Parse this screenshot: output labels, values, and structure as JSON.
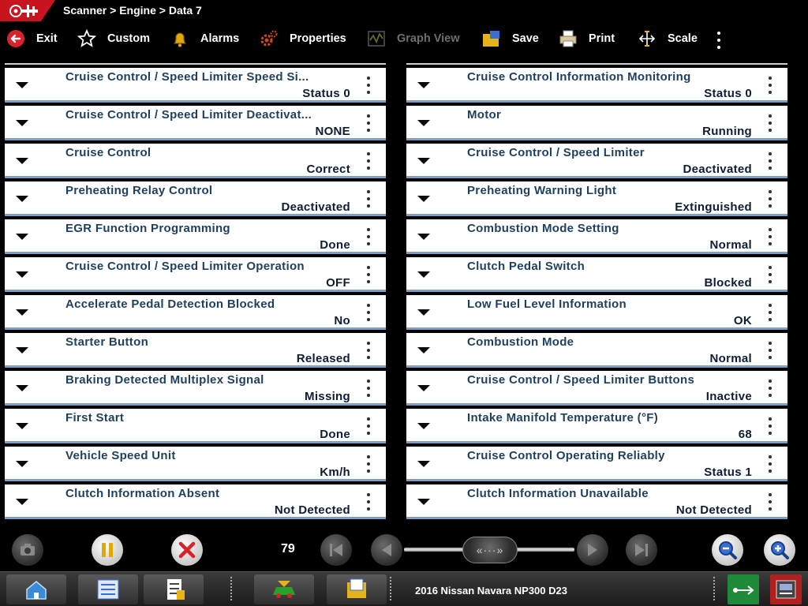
{
  "breadcrumb": "Scanner > Engine > Data 7",
  "toolbar": {
    "exit": "Exit",
    "custom": "Custom",
    "alarms": "Alarms",
    "properties": "Properties",
    "graph_view": "Graph View",
    "save": "Save",
    "print": "Print",
    "scale": "Scale"
  },
  "left_rows": [
    {
      "name": "Cruise Control / Speed Limiter Speed Si...",
      "value": "Status 0"
    },
    {
      "name": "Cruise Control / Speed Limiter Deactivat...",
      "value": "NONE"
    },
    {
      "name": "Cruise Control",
      "value": "Correct"
    },
    {
      "name": "Preheating Relay Control",
      "value": "Deactivated"
    },
    {
      "name": "EGR Function Programming",
      "value": "Done"
    },
    {
      "name": "Cruise Control / Speed Limiter Operation",
      "value": "OFF"
    },
    {
      "name": "Accelerate Pedal Detection Blocked",
      "value": "No"
    },
    {
      "name": "Starter Button",
      "value": "Released"
    },
    {
      "name": "Braking Detected Multiplex Signal",
      "value": "Missing"
    },
    {
      "name": "First Start",
      "value": "Done"
    },
    {
      "name": "Vehicle Speed Unit",
      "value": "Km/h"
    },
    {
      "name": "Clutch Information Absent",
      "value": "Not Detected"
    }
  ],
  "right_rows": [
    {
      "name": "Cruise Control Information Monitoring",
      "value": "Status 0"
    },
    {
      "name": "Motor",
      "value": "Running"
    },
    {
      "name": "Cruise Control / Speed Limiter",
      "value": "Deactivated"
    },
    {
      "name": "Preheating Warning Light",
      "value": "Extinguished"
    },
    {
      "name": "Combustion Mode Setting",
      "value": "Normal"
    },
    {
      "name": "Clutch Pedal Switch",
      "value": "Blocked"
    },
    {
      "name": "Low Fuel Level Information",
      "value": "OK"
    },
    {
      "name": "Combustion Mode",
      "value": "Normal"
    },
    {
      "name": "Cruise Control / Speed Limiter Buttons",
      "value": "Inactive"
    },
    {
      "name": "Intake Manifold Temperature (°F)",
      "value": "68"
    },
    {
      "name": "Cruise Control Operating Reliably",
      "value": "Status 1"
    },
    {
      "name": "Clutch Information Unavailable",
      "value": "Not Detected"
    }
  ],
  "playback": {
    "frame_counter": "79",
    "slider_thumb_glyph": "«···»"
  },
  "taskbar": {
    "vehicle": "2016 Nissan Navara NP300 D23"
  },
  "icons": {
    "exit": "exit-arrow-icon",
    "custom": "star-icon",
    "alarms": "bell-icon",
    "properties": "gear-icon",
    "graph_view": "graph-icon",
    "save": "save-folder-icon",
    "print": "printer-icon",
    "scale": "scale-icon"
  },
  "colors": {
    "row_text": "#1f3f5f",
    "value_text": "#0d1d35",
    "row_border": "#7b9ec4",
    "brand_red": "#c8141e"
  }
}
